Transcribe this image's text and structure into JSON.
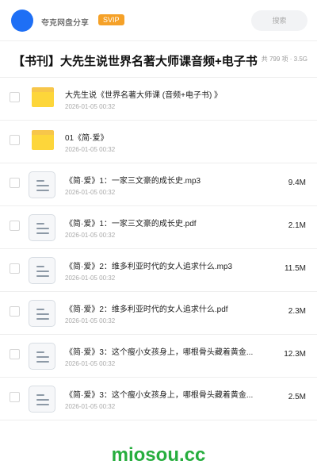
{
  "header": {
    "app_name": "夸克网盘分享",
    "badge": "SVIP",
    "search_placeholder": "搜索"
  },
  "colors": {
    "accent": "#1e6ff5",
    "badge": "#f5a128",
    "folder": "#fdd63a",
    "watermark": "#27ae3e"
  },
  "share": {
    "title": "【书刊】大先生说世界名著大师课音频+电子书",
    "meta": "共 799 项 · 3.5G"
  },
  "items": [
    {
      "type": "folder",
      "icon": "folder-icon",
      "name": "大先生说《世界名著大师课 (音频+电子书) 》",
      "date": "2026-01-05 00:32",
      "size": ""
    },
    {
      "type": "folder",
      "icon": "folder-icon",
      "name": "01《简·爱》",
      "date": "2026-01-05 00:32",
      "size": ""
    },
    {
      "type": "file",
      "icon": "document-icon",
      "name": "《简·爱》1：一家三文豪的成长史.mp3",
      "date": "2026-01-05 00:32",
      "size": "9.4M"
    },
    {
      "type": "file",
      "icon": "document-icon",
      "name": "《简·爱》1：一家三文豪的成长史.pdf",
      "date": "2026-01-05 00:32",
      "size": "2.1M"
    },
    {
      "type": "file",
      "icon": "document-icon",
      "name": "《简·爱》2：维多利亚时代的女人追求什么.mp3",
      "date": "2026-01-05 00:32",
      "size": "11.5M"
    },
    {
      "type": "file",
      "icon": "document-icon",
      "name": "《简·爱》2：维多利亚时代的女人追求什么.pdf",
      "date": "2026-01-05 00:32",
      "size": "2.3M"
    },
    {
      "type": "file",
      "icon": "document-icon",
      "name": "《简·爱》3：这个瘦小女孩身上，哪根骨头藏着黄金...",
      "date": "2026-01-05 00:32",
      "size": "12.3M"
    },
    {
      "type": "file",
      "icon": "document-icon",
      "name": "《简·爱》3：这个瘦小女孩身上，哪根骨头藏着黄金...",
      "date": "2026-01-05 00:32",
      "size": "2.5M"
    }
  ],
  "watermark": "miosou.cc"
}
